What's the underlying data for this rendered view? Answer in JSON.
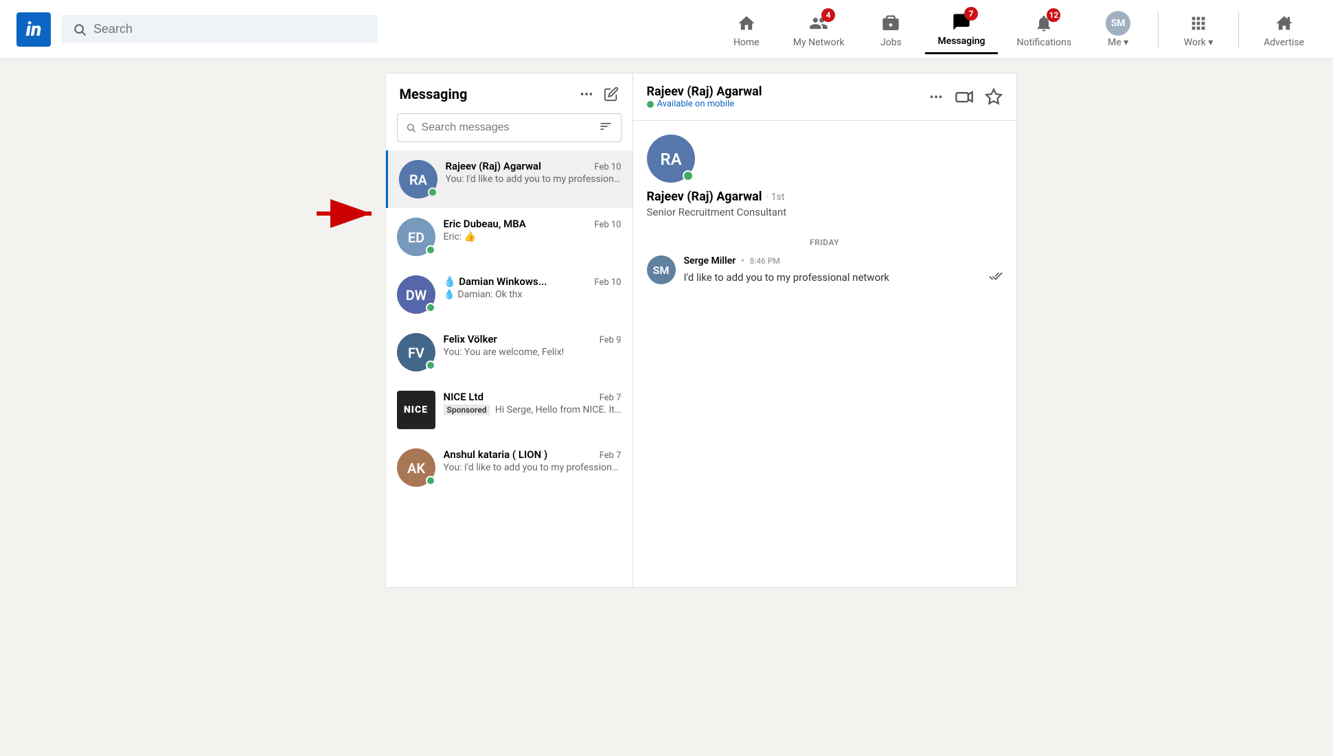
{
  "header": {
    "logo_text": "in",
    "search_placeholder": "Search",
    "nav_items": [
      {
        "id": "home",
        "label": "Home",
        "badge": null,
        "icon": "home-icon"
      },
      {
        "id": "my-network",
        "label": "My Network",
        "badge": "4",
        "icon": "network-icon"
      },
      {
        "id": "jobs",
        "label": "Jobs",
        "badge": null,
        "icon": "jobs-icon"
      },
      {
        "id": "messaging",
        "label": "Messaging",
        "badge": "7",
        "icon": "messaging-icon",
        "active": true
      },
      {
        "id": "notifications",
        "label": "Notifications",
        "badge": "12",
        "icon": "bell-icon"
      },
      {
        "id": "me",
        "label": "Me ▾",
        "badge": null,
        "icon": "avatar-icon"
      }
    ],
    "work_label": "Work ▾",
    "advertise_label": "Advertise"
  },
  "messaging": {
    "title": "Messaging",
    "search_placeholder": "Search messages",
    "conversations": [
      {
        "id": "rajeev",
        "name": "Rajeev (Raj) Agarwal",
        "date": "Feb 10",
        "preview": "You: I'd like to add you to my professional network",
        "active": true,
        "online": true,
        "avatar_color": "#5577aa"
      },
      {
        "id": "eric",
        "name": "Eric Dubeau, MBA",
        "date": "Feb 10",
        "preview": "Eric: 👍",
        "online": true,
        "avatar_color": "#7799bb"
      },
      {
        "id": "damian",
        "name": "Damian Winkows...",
        "date": "Feb 10",
        "preview": "Damian: Ok thx",
        "online": true,
        "has_drop": true,
        "avatar_color": "#5566aa"
      },
      {
        "id": "felix",
        "name": "Felix Völker",
        "date": "Feb 9",
        "preview": "You: You are welcome, Felix!",
        "online": true,
        "avatar_color": "#446688"
      },
      {
        "id": "nice",
        "name": "NICE Ltd",
        "date": "Feb 7",
        "preview": "Sponsored  Hi Serge, Hello from NICE. It's impossible ...",
        "is_sponsored": true,
        "is_company": true
      },
      {
        "id": "anshul",
        "name": "Anshul kataria ( LION )",
        "date": "Feb 7",
        "preview": "You: I'd like to add you to my professional network",
        "online": true,
        "avatar_color": "#aa7755"
      }
    ],
    "active_contact": {
      "name": "Rajeev (Raj) Agarwal",
      "status": "Available on mobile",
      "connection": "1st",
      "title": "Senior Recruitment Consultant",
      "avatar_color": "#5577aa"
    },
    "day_label": "FRIDAY",
    "message": {
      "sender": "Serge Miller",
      "time": "8:46 PM",
      "text": "I'd like to add you to my professional network",
      "avatar_color": "#607080"
    }
  },
  "arrows": {
    "left_arrow": "→",
    "up_arrow": "↑"
  }
}
